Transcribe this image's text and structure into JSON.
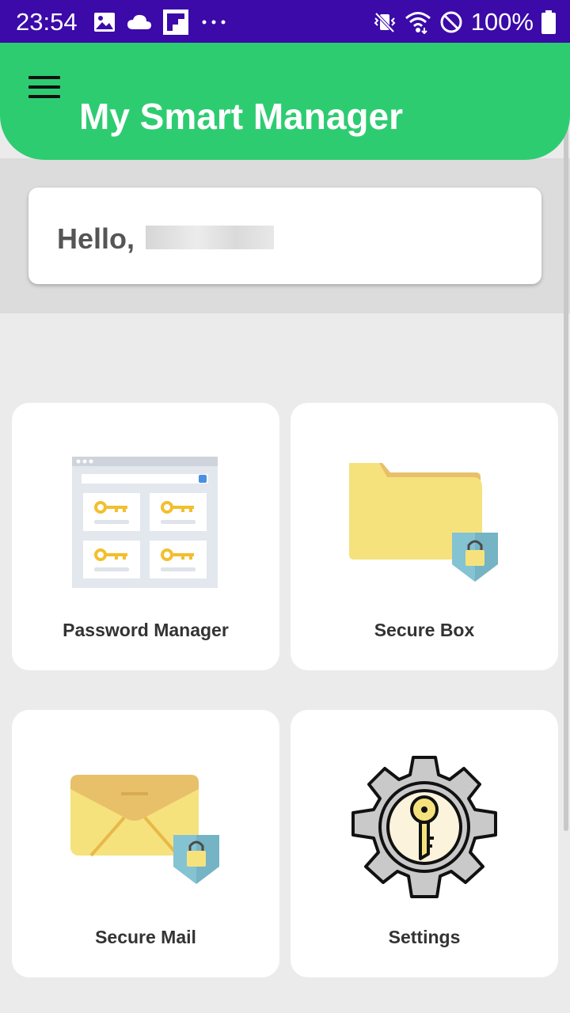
{
  "status_bar": {
    "time": "23:54",
    "battery": "100%",
    "left_icons": [
      "gallery-icon",
      "cloud-icon",
      "flipboard-icon",
      "more-dots-icon"
    ],
    "right_icons": [
      "vibrate-icon",
      "wifi-icon",
      "do-not-disturb-icon",
      "battery-icon"
    ]
  },
  "app_bar": {
    "title": "My Smart Manager",
    "menu_icon": "hamburger-menu-icon"
  },
  "greeting": {
    "prefix": "Hello,"
  },
  "tiles": [
    {
      "label": "Password Manager",
      "icon": "password-manager-icon"
    },
    {
      "label": "Secure Box",
      "icon": "secure-folder-icon"
    },
    {
      "label": "Secure Mail",
      "icon": "secure-mail-icon"
    },
    {
      "label": "Settings",
      "icon": "settings-gear-key-icon"
    }
  ],
  "colors": {
    "status_bar": "#3b0aa8",
    "app_bar": "#2ecc71",
    "background": "#ebebeb",
    "card": "#ffffff"
  }
}
